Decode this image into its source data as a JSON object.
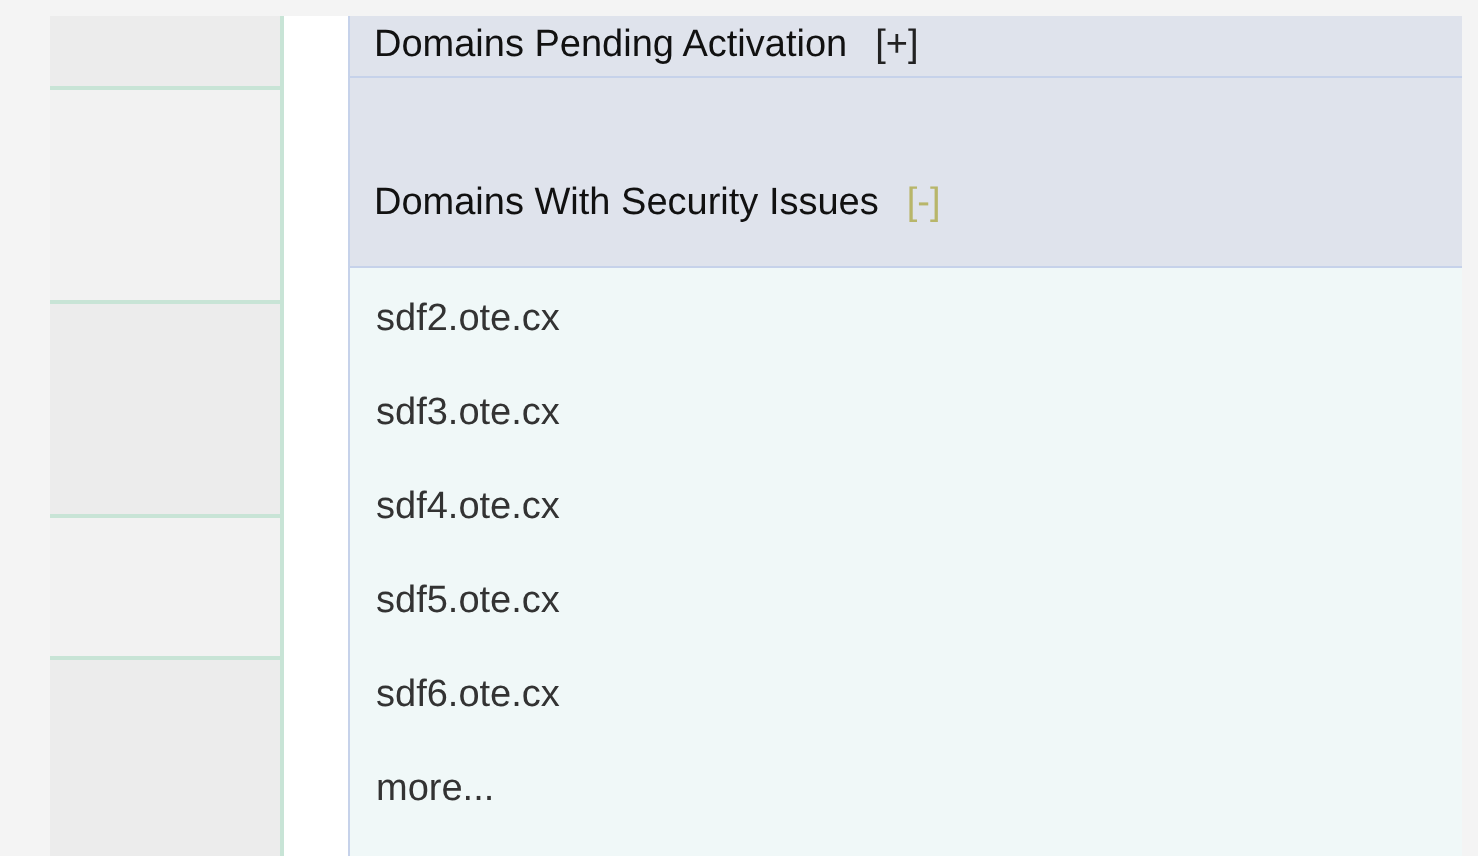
{
  "sections": [
    {
      "title": "Domains Pending Activation",
      "toggle": "[+]",
      "expanded": false
    },
    {
      "title": "Domains With Security Issues",
      "toggle": "[-]",
      "expanded": true,
      "items": [
        "sdf2.ote.cx",
        "sdf3.ote.cx",
        "sdf4.ote.cx",
        "sdf5.ote.cx",
        "sdf6.ote.cx",
        "more..."
      ]
    }
  ]
}
